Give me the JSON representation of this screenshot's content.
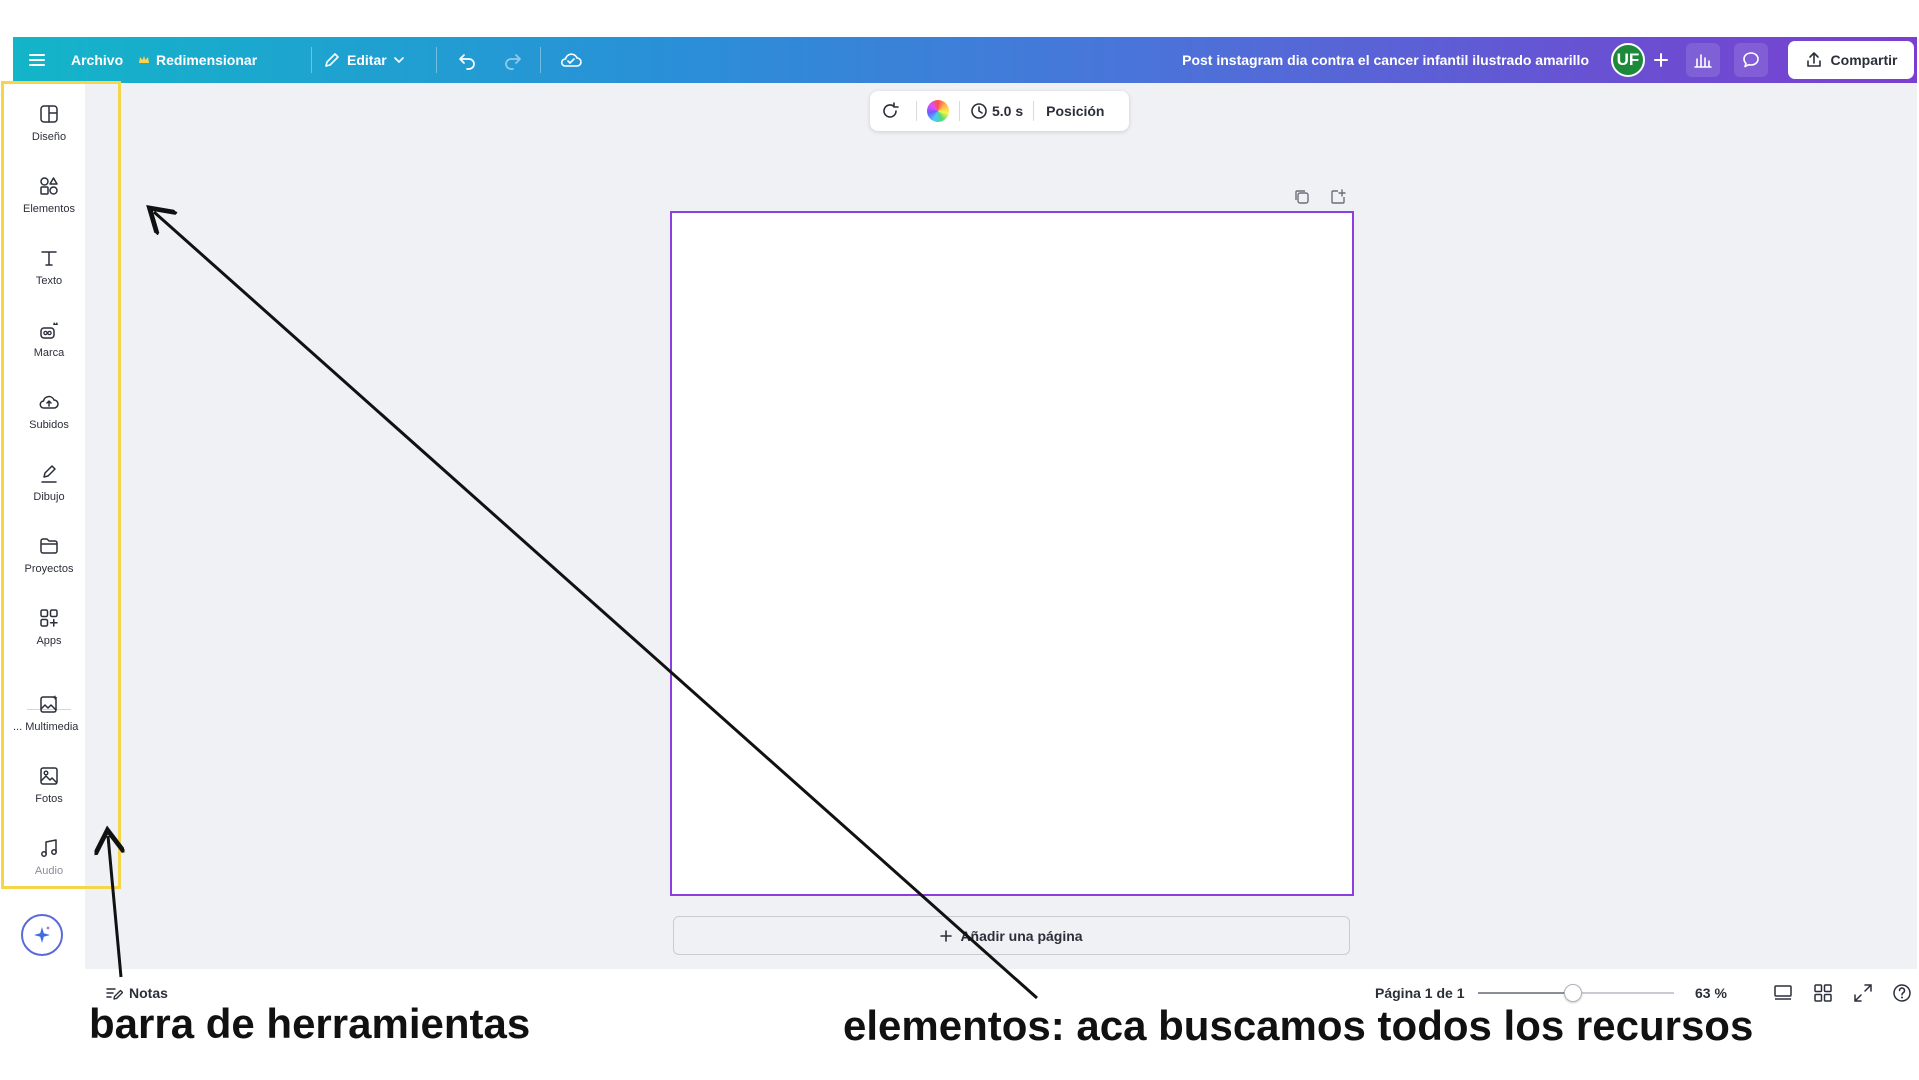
{
  "topbar": {
    "file_label": "Archivo",
    "resize_label": "Redimensionar",
    "edit_label": "Editar",
    "doc_title": "Post instagram dia contra el cancer infantil ilustrado amarillo",
    "avatar_initials": "UF",
    "share_label": "Compartir",
    "gradient_start": "#13b5c8",
    "gradient_end": "#7a3fd0"
  },
  "sidebar": {
    "items": [
      {
        "label": "Diseño",
        "icon": "layout-icon"
      },
      {
        "label": "Elementos",
        "icon": "shapes-icon"
      },
      {
        "label": "Texto",
        "icon": "text-icon"
      },
      {
        "label": "Marca",
        "icon": "brand-icon"
      },
      {
        "label": "Subidos",
        "icon": "cloud-upload-icon"
      },
      {
        "label": "Dibujo",
        "icon": "pen-icon"
      },
      {
        "label": "Proyectos",
        "icon": "folder-icon"
      },
      {
        "label": "Apps",
        "icon": "apps-icon"
      },
      {
        "label": "Multimedia ...",
        "icon": "image-sparkle-icon"
      },
      {
        "label": "Fotos",
        "icon": "photo-icon"
      },
      {
        "label": "Audio",
        "icon": "music-icon"
      }
    ]
  },
  "float_toolbar": {
    "duration": "5.0 s",
    "position_label": "Posición"
  },
  "canvas": {
    "border_color": "#8b3fe0",
    "add_page_label": "Añadir una página"
  },
  "bottombar": {
    "notes_label": "Notas",
    "page_count": "Página 1 de 1",
    "zoom_value": "63 %",
    "zoom_percent": 63
  },
  "annotations": {
    "toolbar_caption": "barra de herramientas",
    "elements_caption": "elementos: aca buscamos todos los recursos",
    "highlight_color": "#f5d64a"
  }
}
